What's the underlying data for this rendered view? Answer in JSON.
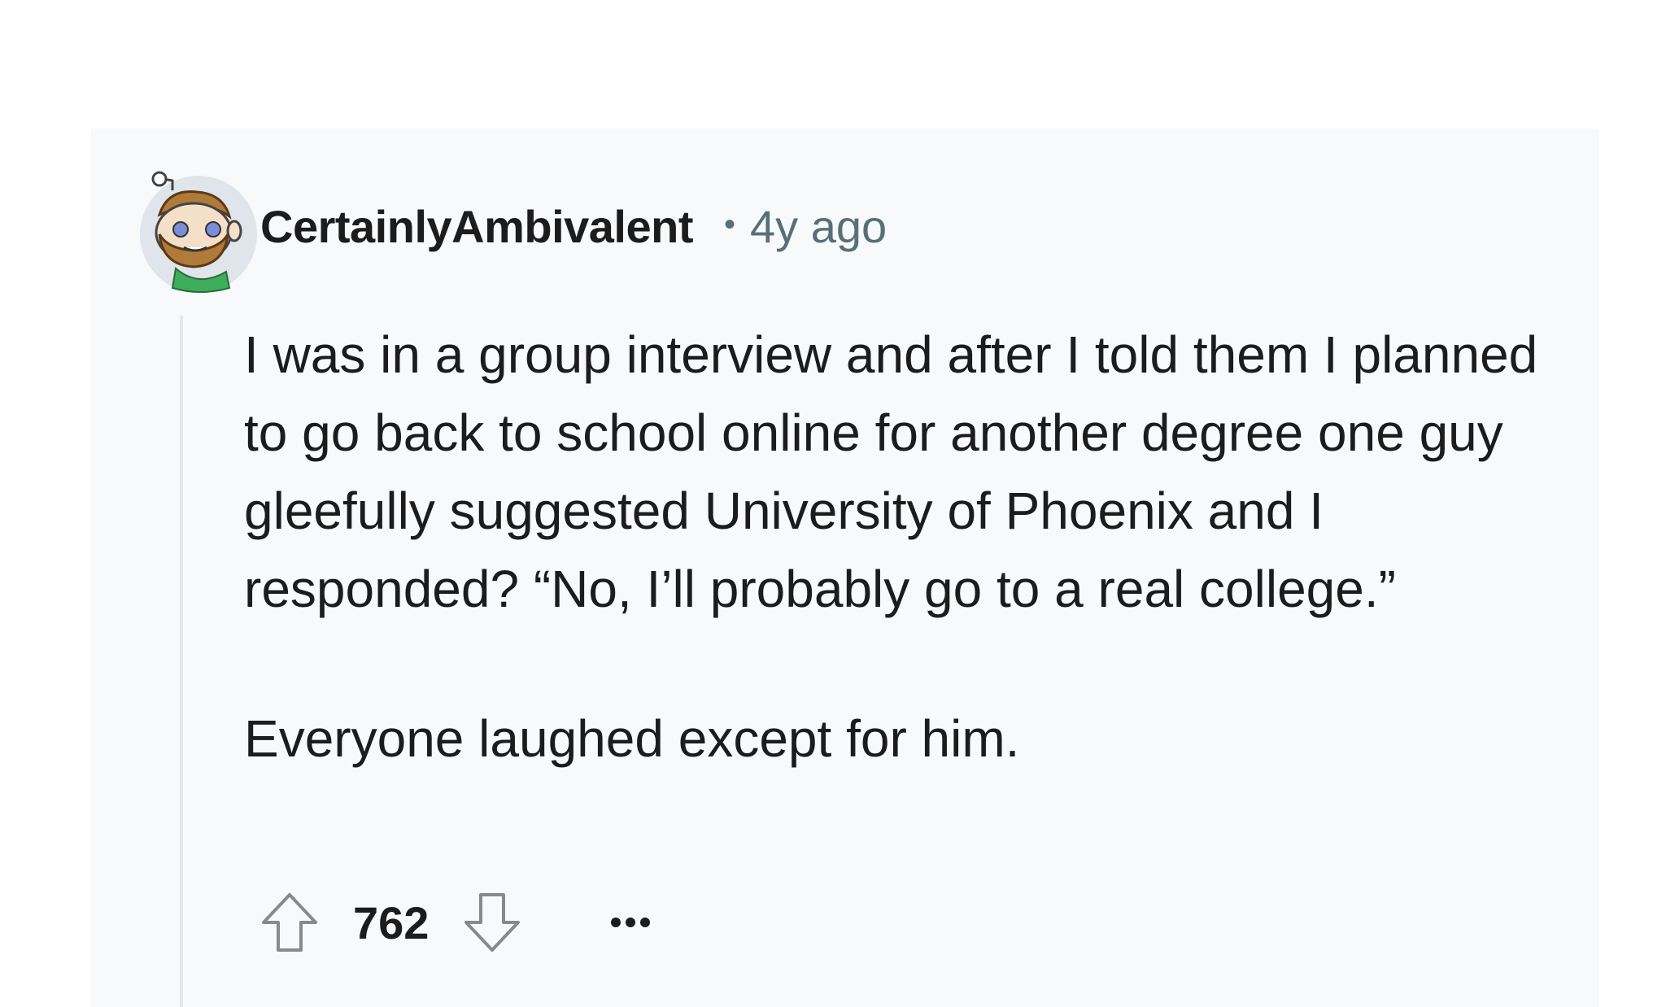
{
  "comment": {
    "username": "CertainlyAmbivalent",
    "separator": "•",
    "time": "4y ago",
    "paragraphs": [
      "I was in a group interview and after I told them I planned to go back to school online for another degree one guy gleefully suggested University of Phoenix and I responded? “No, I’ll probably go to a real college.”",
      "Everyone laughed except for him."
    ],
    "score": "762",
    "icons": {
      "avatar": "snoo-avatar",
      "upvote": "upvote-arrow-icon",
      "downvote": "downvote-arrow-icon",
      "more": "more-options-icon"
    }
  },
  "colors": {
    "card_background": "#f8f9fb",
    "meta_text": "#576f76",
    "body_text": "#1c1c1c",
    "thread_line": "#e5e8eb"
  }
}
